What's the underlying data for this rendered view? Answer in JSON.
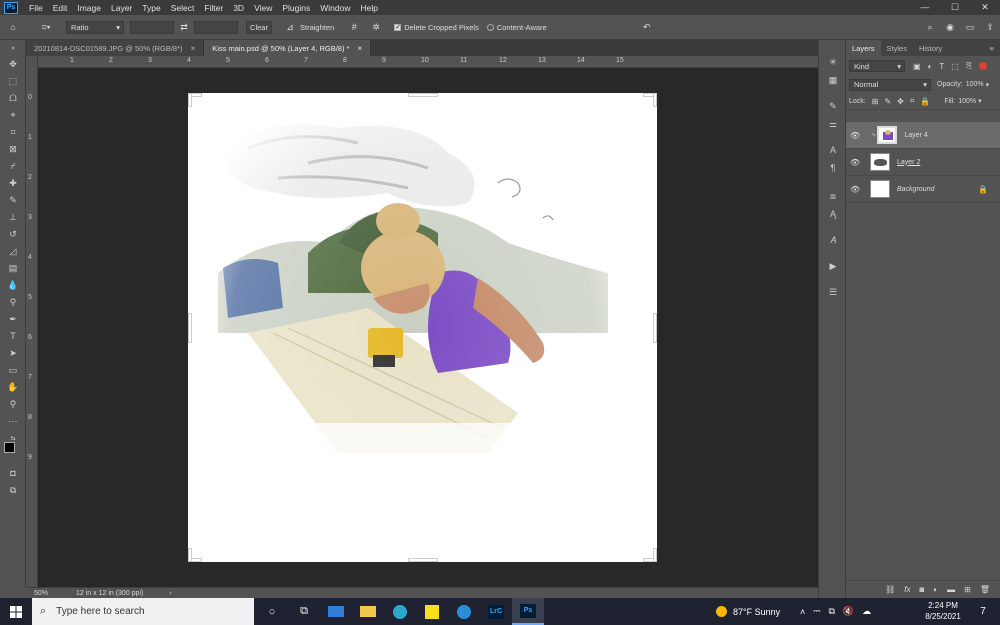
{
  "menubar": {
    "logo": "Ps",
    "items": [
      "File",
      "Edit",
      "Image",
      "Layer",
      "Type",
      "Select",
      "Filter",
      "3D",
      "View",
      "Plugins",
      "Window",
      "Help"
    ],
    "window_controls": [
      "—",
      "☐",
      "✕"
    ]
  },
  "options": {
    "ratio_value": "Ratio",
    "clear_label": "Clear",
    "straighten_label": "Straighten",
    "delete_cropped_label": "Delete Cropped Pixels",
    "content_aware_label": "Content-Aware"
  },
  "tabs": [
    {
      "label": "20210814-DSC01589.JPG @ 50% (RGB/8*)",
      "close": "×"
    },
    {
      "label": "Kiss main.psd @ 50% (Layer 4, RGB/8) *",
      "close": "×"
    }
  ],
  "ruler": {
    "h_numbers": [
      "1",
      "2",
      "3",
      "4",
      "5",
      "6",
      "7",
      "8",
      "9",
      "10",
      "11",
      "12",
      "13",
      "14",
      "15"
    ],
    "v_numbers": [
      "0",
      "1",
      "2",
      "3",
      "4",
      "5",
      "6",
      "7",
      "8",
      "9"
    ]
  },
  "status": {
    "zoom": "50%",
    "doc_size": "12 in x 12 in (300 ppi)",
    "arrow": "›"
  },
  "panels": {
    "tabs": [
      "Layers",
      "Styles",
      "History"
    ],
    "filter_kind": "Kind",
    "blend_mode": "Normal",
    "opacity_label": "Opacity:",
    "opacity_value": "100%",
    "lock_label": "Lock:",
    "fill_label": "Fill:",
    "fill_value": "100%",
    "layers": [
      {
        "name": "Layer 4",
        "selected": true
      },
      {
        "name": "Layer 2",
        "selected": false
      },
      {
        "name": "Background",
        "selected": false,
        "locked": true
      }
    ],
    "footer_icons": [
      "link-icon",
      "fx-icon",
      "mask-icon",
      "adjustment-icon",
      "group-icon",
      "new-layer-icon",
      "trash-icon"
    ],
    "fx_label": "fx"
  },
  "taskbar": {
    "search_placeholder": "Type here to search",
    "lrc_label": "LrC",
    "ps_label": "Ps",
    "weather": "87°F  Sunny",
    "time": "2:24 PM",
    "date": "8/25/2021",
    "notification_count": "7"
  }
}
